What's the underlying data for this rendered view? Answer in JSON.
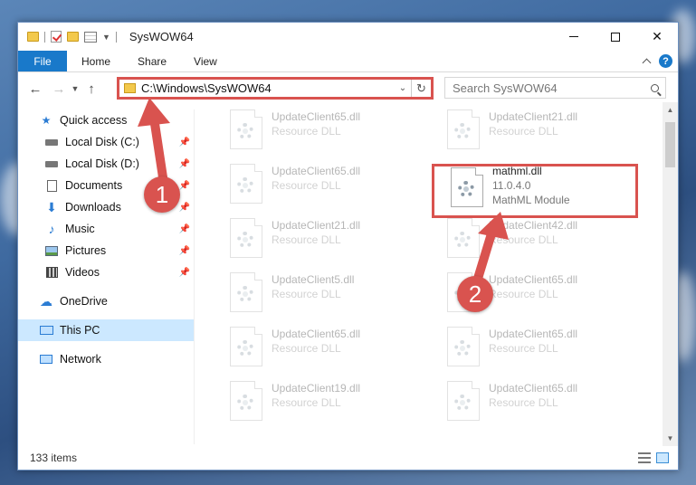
{
  "titlebar": {
    "title": "SysWOW64",
    "minimize": "Minimize",
    "maximize": "Maximize",
    "close": "✕"
  },
  "ribbon": {
    "file": "File",
    "home": "Home",
    "share": "Share",
    "view": "View",
    "help": "?"
  },
  "nav": {
    "address": "C:\\Windows\\SysWOW64",
    "search_placeholder": "Search SysWOW64"
  },
  "sidebar": {
    "quick_access": "Quick access",
    "items": [
      {
        "label": "Local Disk (C:)",
        "icon": "drive-icon"
      },
      {
        "label": "Local Disk (D:)",
        "icon": "drive-icon"
      },
      {
        "label": "Documents",
        "icon": "documents-icon"
      },
      {
        "label": "Downloads",
        "icon": "downloads-icon"
      },
      {
        "label": "Music",
        "icon": "music-icon"
      },
      {
        "label": "Pictures",
        "icon": "pictures-icon"
      },
      {
        "label": "Videos",
        "icon": "videos-icon"
      }
    ],
    "onedrive": "OneDrive",
    "thispc": "This PC",
    "network": "Network"
  },
  "files": [
    {
      "name": "UpdateClient65.dll",
      "desc": "Resource DLL"
    },
    {
      "name": "UpdateClient21.dll",
      "desc": "Resource DLL"
    },
    {
      "name": "UpdateClient65.dll",
      "desc": "Resource DLL"
    },
    {
      "name": "mathml.dll",
      "version": "11.0.4.0",
      "desc": "MathML Module"
    },
    {
      "name": "UpdateClient21.dll",
      "desc": "Resource DLL"
    },
    {
      "name": "UpdateClient42.dll",
      "desc": "Resource DLL"
    },
    {
      "name": "UpdateClient5.dll",
      "desc": "Resource DLL"
    },
    {
      "name": "UpdateClient65.dll",
      "desc": "Resource DLL"
    },
    {
      "name": "UpdateClient65.dll",
      "desc": "Resource DLL"
    },
    {
      "name": "UpdateClient65.dll",
      "desc": "Resource DLL"
    },
    {
      "name": "UpdateClient19.dll",
      "desc": "Resource DLL"
    },
    {
      "name": "UpdateClient65.dll",
      "desc": "Resource DLL"
    }
  ],
  "status": {
    "count": "133 items"
  },
  "callouts": {
    "one": "1",
    "two": "2"
  },
  "colors": {
    "accent": "#1979ca",
    "highlight": "#d9534f",
    "selected": "#cce8ff"
  }
}
